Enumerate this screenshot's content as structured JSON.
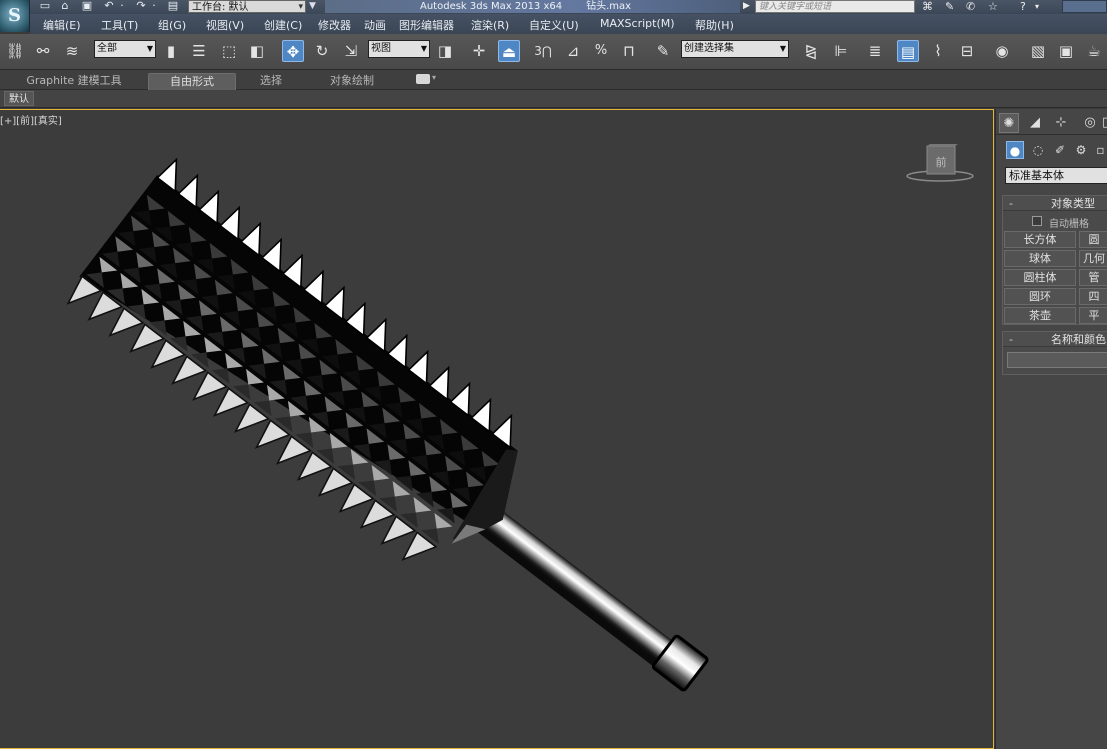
{
  "title_bar": {
    "workspace_label": "工作台: 默认",
    "app_title": "Autodesk 3ds Max  2013 x64",
    "file_name": "钻头.max",
    "search_placeholder": "键入关键字或短语",
    "help_icon": "?"
  },
  "menu": {
    "items": [
      "编辑(E)",
      "工具(T)",
      "组(G)",
      "视图(V)",
      "创建(C)",
      "修改器",
      "动画",
      "图形编辑器",
      "渲染(R)",
      "自定义(U)",
      "MAXScript(M)",
      "帮助(H)"
    ]
  },
  "toolbar": {
    "selection_filter": "全部",
    "ref_coord": "视图",
    "snap_angle_label": "3",
    "named_selection": "创建选择集"
  },
  "ribbon": {
    "tabs": [
      "Graphite 建模工具",
      "自由形式",
      "选择",
      "对象绘制"
    ],
    "active_tab": "自由形式",
    "sub_label": "默认"
  },
  "viewport": {
    "label": "[+][前][真实]",
    "viewcube_face": "前"
  },
  "command_panel": {
    "category": "标准基本体",
    "object_type_title": "对象类型",
    "autogrid_label": "自动栅格",
    "buttons": [
      "长方体",
      "圆",
      "球体",
      "几何",
      "圆柱体",
      "管",
      "圆环",
      "四",
      "茶壶",
      "平"
    ],
    "name_color_title": "名称和颜色"
  },
  "colors": {
    "viewport_border": "#e3b63a",
    "active_tool": "#4f87c4"
  }
}
